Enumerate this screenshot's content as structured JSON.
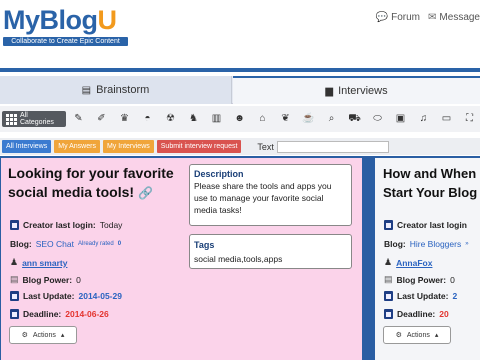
{
  "header": {
    "logo": {
      "my": "My",
      "blog": "Blog",
      "u": "U",
      "tagline": "Collaborate to Create Epic Content"
    },
    "links": [
      {
        "icon": "chat-icon",
        "glyph": "💬",
        "label": "Forum"
      },
      {
        "icon": "mail-icon",
        "glyph": "✉",
        "label": "Message"
      }
    ]
  },
  "tabs": [
    {
      "label": "Brainstorm",
      "glyph": "▤",
      "active": false
    },
    {
      "label": "Interviews",
      "glyph": "▆",
      "active": true
    }
  ],
  "categories": {
    "all_label": "All Categories",
    "icons": [
      {
        "name": "pencil-icon",
        "glyph": "✎"
      },
      {
        "name": "brush-icon",
        "glyph": "✐"
      },
      {
        "name": "trophy-icon",
        "glyph": "♛"
      },
      {
        "name": "bag-icon",
        "glyph": "◓"
      },
      {
        "name": "radiation-icon",
        "glyph": "☢"
      },
      {
        "name": "horse-icon",
        "glyph": "♞"
      },
      {
        "name": "book-icon",
        "glyph": "▥"
      },
      {
        "name": "people-icon",
        "glyph": "☻"
      },
      {
        "name": "home-icon",
        "glyph": "⌂"
      },
      {
        "name": "leaf-icon",
        "glyph": "❦"
      },
      {
        "name": "coffee-icon",
        "glyph": "☕"
      },
      {
        "name": "search-icon",
        "glyph": "⌕"
      },
      {
        "name": "car-icon",
        "glyph": "⛟"
      },
      {
        "name": "football-icon",
        "glyph": "⬭"
      },
      {
        "name": "briefcase-icon",
        "glyph": "▣"
      },
      {
        "name": "bell-icon",
        "glyph": "♫"
      },
      {
        "name": "laptop-icon",
        "glyph": "▭"
      },
      {
        "name": "expand-icon",
        "glyph": "⛶"
      }
    ]
  },
  "filters": {
    "all": "All Interviews",
    "answers": "My Answers",
    "interviews": "My Interviews",
    "submit": "Submit interview request",
    "text_label": "Text",
    "text_value": ""
  },
  "cards": [
    {
      "title": "Looking for your favorite social media tools!",
      "description_label": "Description",
      "description": "Please share the tools and apps you use to manage your favorite social media tasks!",
      "tags_label": "Tags",
      "tags": "social media,tools,apps",
      "creator_login_label": "Creator last login:",
      "creator_login": "Today",
      "blog_label": "Blog:",
      "blog": "SEO Chat",
      "already_rated": "Already rated",
      "rated_count": "0",
      "author": "ann smarty",
      "power_label": "Blog Power:",
      "power": "0",
      "update_label": "Last Update:",
      "update": "2014-05-29",
      "deadline_label": "Deadline:",
      "deadline": "2014-06-26",
      "actions": "Actions"
    },
    {
      "title": "How and When",
      "title2": "Start Your Blog",
      "creator_login_label": "Creator last login",
      "blog_label": "Blog:",
      "blog": "Hire Bloggers",
      "blog_suffix": "»",
      "author": "AnnaFox",
      "power_label": "Blog Power:",
      "power": "0",
      "update_label": "Last Update:",
      "update": "2",
      "deadline_label": "Deadline:",
      "deadline": "20",
      "actions": "Actions"
    }
  ]
}
